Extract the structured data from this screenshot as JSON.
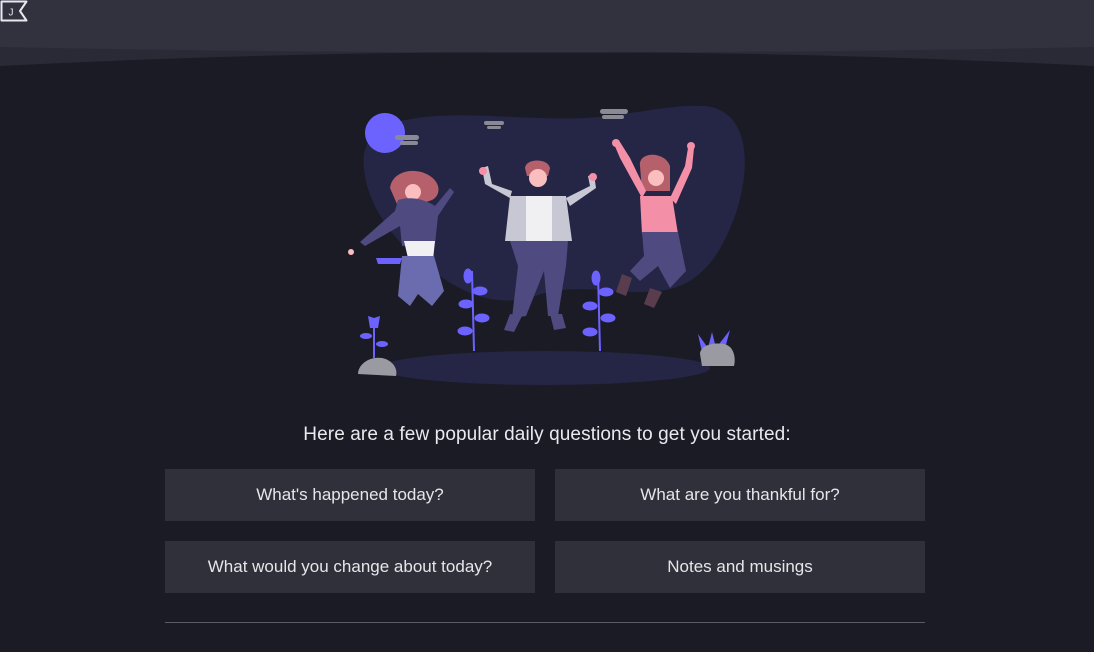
{
  "header": {
    "logo_letter": "J",
    "bar_color": "#2f3039",
    "bar_shadow_color": "#272833"
  },
  "illustration": {
    "name": "people-jumping-illustration",
    "accent_color": "#6c63ff",
    "blob_color": "#252545",
    "skin_color": "#fbbebe",
    "pink_color": "#f48fa8"
  },
  "main": {
    "prompt": "Here are a few popular daily questions to get you started:",
    "questions": [
      {
        "label": "What's happened today?"
      },
      {
        "label": "What are you thankful for?"
      },
      {
        "label": "What would you change about today?"
      },
      {
        "label": "Notes and musings"
      }
    ],
    "button_color": "#2f3039",
    "background_color": "#1b1b26"
  }
}
